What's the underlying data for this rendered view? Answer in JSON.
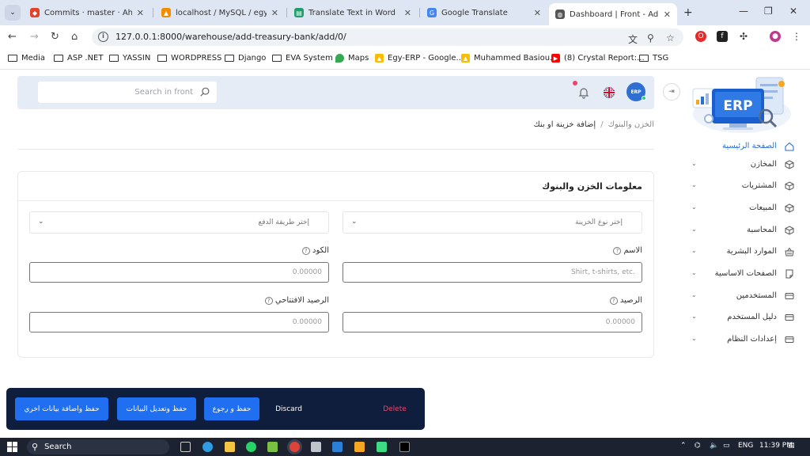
{
  "browser": {
    "tabs": [
      {
        "title": "Commits · master · Ahmed",
        "favicon": "gitlab-icon",
        "color": "#e24329"
      },
      {
        "title": "localhost / MySQL / egy-erp",
        "favicon": "phpmyadmin-icon",
        "color": "#f28b00"
      },
      {
        "title": "Translate Text in Word",
        "favicon": "doc-icon",
        "color": "#1e9e6a"
      },
      {
        "title": "Google Translate",
        "favicon": "translate-icon",
        "color": "#4285f4"
      },
      {
        "title": "Dashboard | Front - Admin",
        "favicon": "globe-icon",
        "color": "#555555"
      }
    ],
    "url": "127.0.0.1:8000/warehouse/add-treasury-bank/add/0/",
    "bookmarks": [
      {
        "label": "Media",
        "type": "folder"
      },
      {
        "label": "ASP .NET",
        "type": "folder"
      },
      {
        "label": "YASSIN",
        "type": "folder"
      },
      {
        "label": "WORDPRESS",
        "type": "folder"
      },
      {
        "label": "Django",
        "type": "folder"
      },
      {
        "label": "EVA System",
        "type": "folder"
      },
      {
        "label": "Maps",
        "type": "maps"
      },
      {
        "label": "Egy-ERP - Google...",
        "type": "drive"
      },
      {
        "label": "Muhammed Basiou...",
        "type": "drive"
      },
      {
        "label": "(8) Crystal Report:...",
        "type": "youtube"
      },
      {
        "label": "TSG",
        "type": "folder"
      }
    ]
  },
  "header": {
    "search_placeholder": "Search in front",
    "avatar_text": "ERP"
  },
  "breadcrumb": {
    "parent": "الخزن والبنوك",
    "current": "إضافة خزينة او بنك"
  },
  "form": {
    "title": "معلومات الخزن والبنوك",
    "treasury_type_placeholder": "إختر نوع الخزينة",
    "payment_method_placeholder": "إختر طريقة الدفع",
    "name_label": "الاسم",
    "name_placeholder": "Shirt, t-shirts, etc.",
    "code_label": "الكود",
    "code_placeholder": "0.00000",
    "balance_label": "الرصيد",
    "balance_placeholder": "0.00000",
    "opening_balance_label": "الرصيد الافتتاحي",
    "opening_balance_placeholder": "0.00000"
  },
  "sidebar": {
    "logo_text": "ERP",
    "items": [
      {
        "label": "الصفحة الرئيسية",
        "icon": "home-icon",
        "has_children": false
      },
      {
        "label": "المخازن",
        "icon": "box-icon",
        "has_children": true
      },
      {
        "label": "المشتريات",
        "icon": "box-icon",
        "has_children": true
      },
      {
        "label": "المبيعات",
        "icon": "box-icon",
        "has_children": true
      },
      {
        "label": "المحاسبة",
        "icon": "box-icon",
        "has_children": true
      },
      {
        "label": "الموارد البشرية",
        "icon": "basket-icon",
        "has_children": true
      },
      {
        "label": "الصفحات الاساسية",
        "icon": "page-icon",
        "has_children": true
      },
      {
        "label": "المستخدمين",
        "icon": "card-icon",
        "has_children": true
      },
      {
        "label": "دليل المستخدم",
        "icon": "card-icon",
        "has_children": true
      },
      {
        "label": "إعدادات النظام",
        "icon": "card-icon",
        "has_children": true
      }
    ]
  },
  "actions": {
    "save_add_another": "حفظ واضافة بيانات اخري",
    "save_continue_edit": "حفظ وتعديل البيانات",
    "save_return": "حفظ و رجوع",
    "discard": "Discard",
    "delete": "Delete"
  },
  "taskbar": {
    "search": "Search",
    "language": "ENG",
    "time": "11:39 PM"
  },
  "colors": {
    "primary": "#1f6ff0",
    "action_bar": "#101e3d",
    "delete": "#e8456b",
    "header_bg": "#e6ecf6"
  }
}
